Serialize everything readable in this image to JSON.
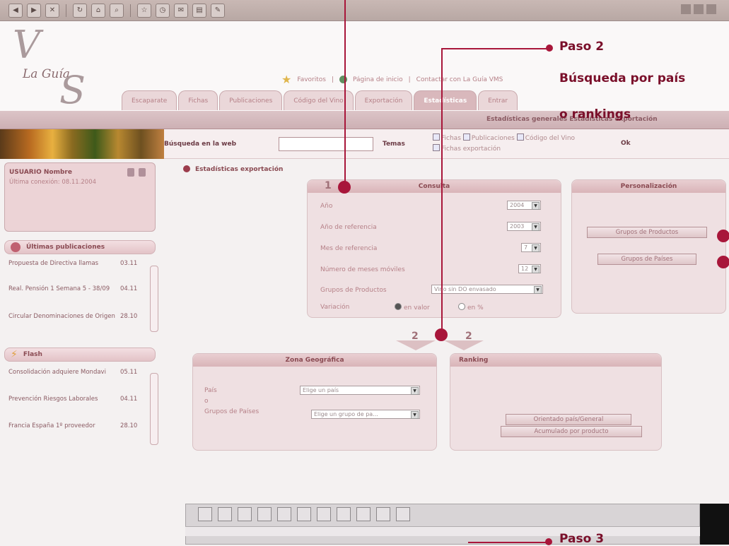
{
  "header": {
    "favoritos": "Favoritos",
    "pagina_inicio": "Página de inicio",
    "contacto": "Contactar con La Guía VMS"
  },
  "tabs": [
    {
      "label": "Escaparate"
    },
    {
      "label": "Fichas"
    },
    {
      "label": "Publicaciones"
    },
    {
      "label": "Código del Vino"
    },
    {
      "label": "Exportación"
    },
    {
      "label": "Estadísticas",
      "active": true
    },
    {
      "label": "Entrar"
    }
  ],
  "subnav": {
    "label": "Estadísticas generales   Estadísticas exportación"
  },
  "search": {
    "label": "Búsqueda en la web",
    "value": "",
    "temas_label": "Temas",
    "checks": [
      "Fichas",
      "Publicaciones",
      "Código del Vino",
      "Fichas exportación"
    ],
    "ok_label": "Ok"
  },
  "user": {
    "name": "USUARIO Nombre",
    "last_visit": "Última conexión: 08.11.2004"
  },
  "publicaciones": {
    "title": "Últimas publicaciones",
    "items": [
      {
        "title": "Propuesta de Directiva llamas",
        "date": "03.11"
      },
      {
        "title": "Real. Pensión 1 Semana 5 - 38/09",
        "date": "04.11"
      },
      {
        "title": "Circular Denominaciones de Origen",
        "date": "28.10"
      }
    ]
  },
  "flash": {
    "title": "Flash",
    "items": [
      {
        "title": "Consolidación adquiere Mondavi",
        "date": "05.11"
      },
      {
        "title": "Prevención Riesgos Laborales",
        "date": "04.11"
      },
      {
        "title": "Francia España 1º proveedor",
        "date": "28.10"
      }
    ]
  },
  "breadcrumb": "Estadísticas exportación",
  "consulta": {
    "step": "1",
    "title": "Consulta",
    "rows": [
      {
        "label": "Año",
        "value": "2004"
      },
      {
        "label": "Año de referencia",
        "value": "2003"
      },
      {
        "label": "Mes de referencia",
        "value": "7"
      },
      {
        "label": "Número de meses móviles",
        "value": "12"
      },
      {
        "label": "Grupos de Productos",
        "value": "Vino sin DO envasado"
      }
    ],
    "variacion_label": "Variación",
    "variacion_options": [
      "en valor",
      "en %"
    ],
    "variacion_selected": "en valor"
  },
  "personalizacion": {
    "title": "Personalización",
    "buttons": [
      "Grupos de Productos",
      "Grupos de Países"
    ]
  },
  "step2": {
    "left": "2",
    "right": "2"
  },
  "zona": {
    "title": "Zona Geográfica",
    "pais_label": "País",
    "or_label": "o",
    "grupo_label": "Grupos de Países",
    "pais_value": "Elige un país",
    "grupo_value": "Elige un grupo de pa..."
  },
  "ranking": {
    "title": "Ranking",
    "buttons": [
      "Orientado país/General",
      "Acumulado por producto"
    ]
  },
  "annotations": {
    "paso2": "Paso 2",
    "paso2_desc1": "Búsqueda por país",
    "paso2_desc2": "o rankings",
    "paso3": "Paso 3"
  }
}
